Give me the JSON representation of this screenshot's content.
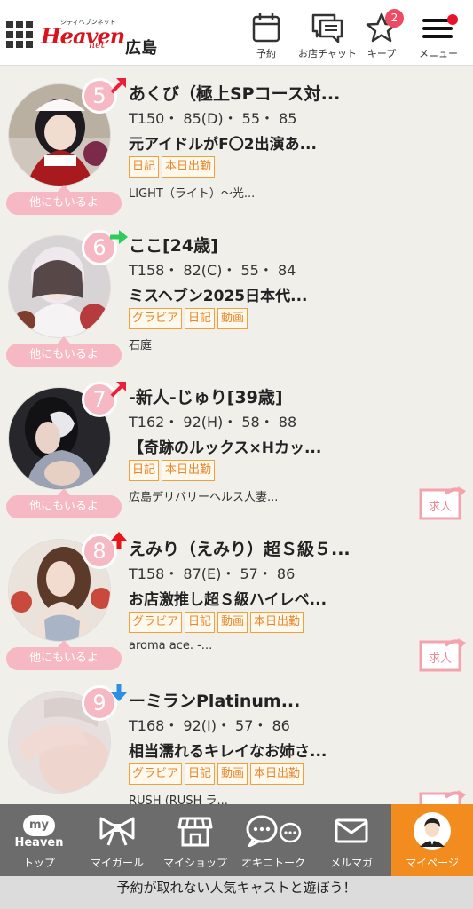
{
  "header": {
    "logo_text": "Heaven",
    "logo_sub": "シティヘブンネット",
    "logo_net": "net",
    "area": "広島",
    "buttons": [
      {
        "label": "予約",
        "icon": "calendar-icon"
      },
      {
        "label": "お店チャット",
        "icon": "chat-icon"
      },
      {
        "label": "キープ",
        "icon": "star-icon",
        "badge": "2"
      },
      {
        "label": "メニュー",
        "icon": "hamburger-icon"
      }
    ]
  },
  "colors": {
    "rank_pink": "#f6b8c2",
    "tag_orange": "#f0a03c",
    "tab_gray": "#6c6c6c",
    "tab_active": "#f28c1e"
  },
  "items": [
    {
      "rank": "5",
      "trend": "up-right",
      "name": "あくび（極上SPコース対...",
      "spec": "T150・ 85(D)・ 55・ 85",
      "catch": "元アイドルがF〇2出演あ...",
      "tags": [
        "日記",
        "本日出勤"
      ],
      "shop": "LIGHT（ライト）～光...",
      "other": "他にもいるよ",
      "kyujin": false
    },
    {
      "rank": "6",
      "trend": "right",
      "name": "ここ[24歳]",
      "spec": "T158・ 82(C)・ 55・ 84",
      "catch": "ミスヘブン2025日本代...",
      "tags": [
        "グラビア",
        "日記",
        "動画"
      ],
      "shop": "石庭",
      "other": "他にもいるよ",
      "kyujin": false
    },
    {
      "rank": "7",
      "trend": "up-right",
      "name": "-新人-じゅり[39歳]",
      "spec": "T162・ 92(H)・ 58・ 88",
      "catch": "【奇跡のルックス×Hカッ...",
      "tags": [
        "日記",
        "本日出勤"
      ],
      "shop": "広島デリバリーヘルス人妻...",
      "other": "他にもいるよ",
      "kyujin": true,
      "kyujin_label": "求人"
    },
    {
      "rank": "8",
      "trend": "up",
      "name": "えみり（えみり）超Ｓ級５...",
      "spec": "T158・ 87(E)・ 57・ 86",
      "catch": "お店激推し超Ｓ級ハイレベ...",
      "tags": [
        "グラビア",
        "日記",
        "動画",
        "本日出勤"
      ],
      "shop": "aroma ace. -...",
      "other": "他にもいるよ",
      "kyujin": true,
      "kyujin_label": "求人"
    },
    {
      "rank": "9",
      "trend": "down",
      "name": "ーミランPlatinum...",
      "spec": "T168・ 92(I)・ 57・ 86",
      "catch": "相当濡れるキレイなお姉さ...",
      "tags": [
        "グラビア",
        "日記",
        "動画",
        "本日出勤"
      ],
      "shop": "RUSH (RUSH ラ...",
      "other": "",
      "kyujin": true,
      "kyujin_label": ""
    }
  ],
  "tabbar": {
    "tabs": [
      {
        "label": "トップ",
        "icon": "my-heaven-icon",
        "icon_text_1": "my",
        "icon_text_2": "Heaven"
      },
      {
        "label": "マイガール",
        "icon": "ribbon-icon"
      },
      {
        "label": "マイショップ",
        "icon": "shop-icon"
      },
      {
        "label": "オキニトーク",
        "icon": "talk-icon"
      },
      {
        "label": "メルマガ",
        "icon": "mail-icon"
      },
      {
        "label": "マイページ",
        "icon": "user-icon"
      }
    ]
  },
  "banner": "予約が取れない人気キャストと遊ぼう！"
}
